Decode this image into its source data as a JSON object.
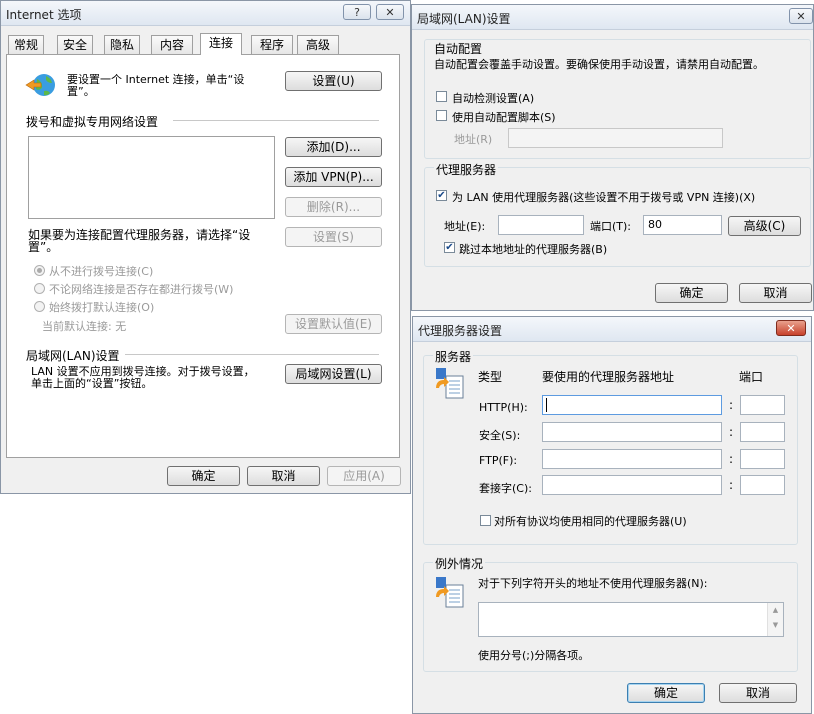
{
  "internet_options": {
    "title": "Internet 选项",
    "help_btn": "?",
    "close_btn": "✕",
    "tabs": [
      "常规",
      "安全",
      "隐私",
      "内容",
      "连接",
      "程序",
      "高级"
    ],
    "setup_text": "要设置一个 Internet 连接，单击“设置”。",
    "setup_btn": "设置(U)",
    "dialup_header": "拨号和虚拟专用网络设置",
    "add_btn": "添加(D)...",
    "add_vpn_btn": "添加 VPN(P)...",
    "remove_btn": "删除(R)...",
    "proxy_text": "如果要为连接配置代理服务器，请选择“设置”。",
    "settings_btn": "设置(S)",
    "radio_never": "从不进行拨号连接(C)",
    "radio_whenever": "不论网络连接是否存在都进行拨号(W)",
    "radio_always": "始终拨打默认连接(O)",
    "current_default": "当前默认连接:  无",
    "set_default_btn": "设置默认值(E)",
    "lan_header": "局域网(LAN)设置",
    "lan_text": "LAN 设置不应用到拨号连接。对于拨号设置，单击上面的“设置”按钮。",
    "lan_btn": "局域网设置(L)",
    "ok": "确定",
    "cancel": "取消",
    "apply": "应用(A)"
  },
  "lan_settings": {
    "title": "局域网(LAN)设置",
    "close_btn": "✕",
    "auto_header": "自动配置",
    "auto_desc": "自动配置会覆盖手动设置。要确保使用手动设置，请禁用自动配置。",
    "auto_detect": "自动检测设置(A)",
    "auto_script": "使用自动配置脚本(S)",
    "address_label": "地址(R)",
    "proxy_header": "代理服务器",
    "use_proxy": "为 LAN 使用代理服务器(这些设置不用于拨号或 VPN 连接)(X)",
    "addr_label": "地址(E):",
    "addr_value": "",
    "port_label": "端口(T):",
    "port_value": "80",
    "advanced_btn": "高级(C)",
    "bypass_local": "跳过本地地址的代理服务器(B)",
    "ok": "确定",
    "cancel": "取消"
  },
  "proxy_settings": {
    "title": "代理服务器设置",
    "close_btn": "✕",
    "servers_header": "服务器",
    "col_type": "类型",
    "col_address": "要使用的代理服务器地址",
    "col_port": "端口",
    "rows": [
      {
        "label": "HTTP(H):",
        "address": "",
        "port": ""
      },
      {
        "label": "安全(S):",
        "address": "",
        "port": ""
      },
      {
        "label": "FTP(F):",
        "address": "",
        "port": ""
      },
      {
        "label": "套接字(C):",
        "address": "",
        "port": ""
      }
    ],
    "colon": ":",
    "same_proxy": "对所有协议均使用相同的代理服务器(U)",
    "exceptions_header": "例外情况",
    "exceptions_desc": "对于下列字符开头的地址不使用代理服务器(N):",
    "exceptions_hint": "使用分号(;)分隔各项。",
    "ok": "确定",
    "cancel": "取消"
  },
  "colors": {
    "window_bg": "#f0f0f0",
    "title_gradient_top": "#f4f7fb",
    "close_red": "#c7412b",
    "check_blue": "#1a4a8a"
  }
}
